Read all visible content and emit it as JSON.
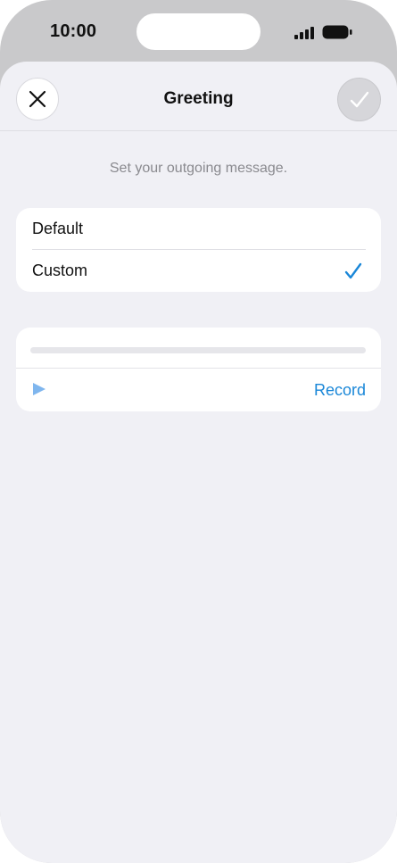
{
  "status_bar": {
    "time": "10:00"
  },
  "nav": {
    "title": "Greeting",
    "close_icon": "close-icon",
    "done_icon": "checkmark-icon"
  },
  "subtitle": "Set your outgoing message.",
  "options": [
    {
      "label": "Default",
      "selected": false
    },
    {
      "label": "Custom",
      "selected": true
    }
  ],
  "player": {
    "progress": 0,
    "play_icon": "play-icon",
    "record_label": "Record"
  },
  "colors": {
    "accent": "#1a87d8",
    "background": "#f0f0f5",
    "card": "#ffffff",
    "secondary_text": "#8a8a8f",
    "play_icon": "#7fb6ee"
  }
}
